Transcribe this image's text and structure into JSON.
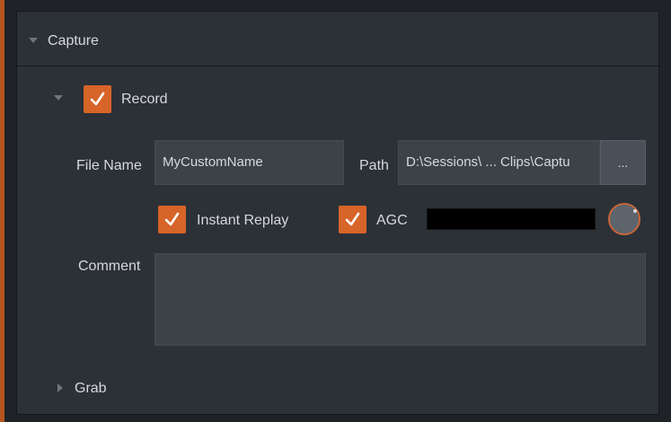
{
  "sections": {
    "capture": {
      "label": "Capture"
    },
    "record": {
      "label": "Record",
      "checked": true,
      "file_name_label": "File Name",
      "file_name_value": "MyCustomName",
      "path_label": "Path",
      "path_value": "D:\\Sessions\\ ... Clips\\Captu",
      "browse_label": "...",
      "instant_replay_label": "Instant Replay",
      "instant_replay_checked": true,
      "agc_label": "AGC",
      "agc_checked": true,
      "comment_label": "Comment",
      "comment_value": ""
    },
    "grab": {
      "label": "Grab"
    }
  },
  "colors": {
    "accent_orange": "#d76428",
    "panel_bg": "#2c3137",
    "field_bg": "#3c4248"
  },
  "icons": {
    "capture_expander": "triangle-down",
    "record_expander": "triangle-down",
    "grab_expander": "triangle-right",
    "checkmark": "check"
  }
}
